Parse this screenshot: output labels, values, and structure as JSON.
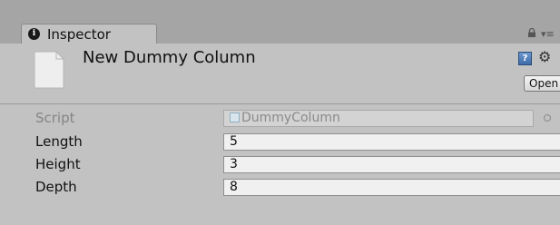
{
  "window": {
    "tab_label": "Inspector",
    "tab_icon": "info-icon"
  },
  "header": {
    "asset_name": "New Dummy Column",
    "open_label": "Open"
  },
  "properties": [
    {
      "label": "Script",
      "value": "DummyColumn",
      "disabled": true
    },
    {
      "label": "Length",
      "value": "5"
    },
    {
      "label": "Height",
      "value": "3"
    },
    {
      "label": "Depth",
      "value": "8"
    }
  ]
}
